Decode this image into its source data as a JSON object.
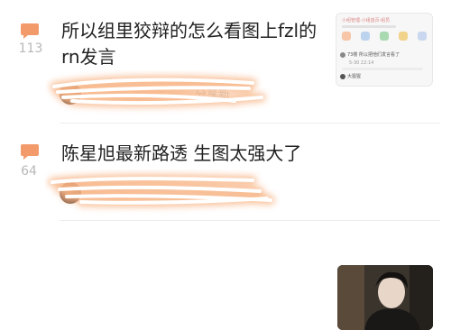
{
  "posts": [
    {
      "comment_count": "113",
      "title_line1": "所以组里狡辩的怎么看图上fzl的",
      "title_line2": "rn发言",
      "meta_text": "分享新",
      "thumbnail": {
        "header_text": "小组管理·小组首页·组员",
        "row1_text": "73楼 所以把他们发言看了",
        "row1_time": "5-30 22:14",
        "row2_text": "大猩猩"
      }
    },
    {
      "comment_count": "64",
      "title_line1": "陈星旭最新路透 生图太强大了",
      "meta_text": "",
      "thumbnail": {}
    }
  ],
  "colors": {
    "accent": "#f39a6b",
    "count_text": "#b8b8b8",
    "title_text": "#222222",
    "scribble": "#f7b07f"
  },
  "icons": {
    "comment": "speech-bubble-icon"
  }
}
